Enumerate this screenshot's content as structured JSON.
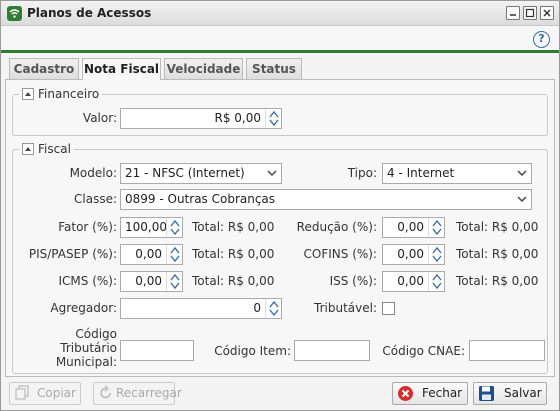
{
  "window": {
    "title": "Planos de Acessos",
    "accent": "#2e7d32"
  },
  "tabs": [
    {
      "label": "Cadastro"
    },
    {
      "label": "Nota Fiscal",
      "active": true
    },
    {
      "label": "Velocidade"
    },
    {
      "label": "Status"
    }
  ],
  "financeiro": {
    "legend": "Financeiro",
    "valor_label": "Valor:",
    "valor_value": "R$ 0,00"
  },
  "fiscal": {
    "legend": "Fiscal",
    "modelo_label": "Modelo:",
    "modelo_value": "21 - NFSC (Internet)",
    "tipo_label": "Tipo:",
    "tipo_value": "4 - Internet",
    "classe_label": "Classe:",
    "classe_value": "0899 - Outras Cobranças",
    "fator_label": "Fator (%):",
    "fator_value": "100,00",
    "fator_total": "Total: R$ 0,00",
    "reducao_label": "Redução (%):",
    "reducao_value": "0,00",
    "reducao_total": "Total: R$ 0,00",
    "pis_label": "PIS/PASEP (%):",
    "pis_value": "0,00",
    "pis_total": "Total: R$ 0,00",
    "cofins_label": "COFINS (%):",
    "cofins_value": "0,00",
    "cofins_total": "Total: R$ 0,00",
    "icms_label": "ICMS (%):",
    "icms_value": "0,00",
    "icms_total": "Total: R$ 0,00",
    "iss_label": "ISS (%):",
    "iss_value": "0,00",
    "iss_total": "Total: R$ 0,00",
    "agregador_label": "Agregador:",
    "agregador_value": "0",
    "tributavel_label": "Tributável:",
    "tributavel_checked": false,
    "codigo_trib_label_1": "Código",
    "codigo_trib_label_2": "Tributário",
    "codigo_trib_label_3": "Municipal:",
    "codigo_trib_value": "",
    "codigo_item_label": "Código Item:",
    "codigo_item_value": "",
    "codigo_cnae_label": "Código CNAE:",
    "codigo_cnae_value": ""
  },
  "footer": {
    "copiar": "Copiar",
    "recarregar": "Recarregar",
    "fechar": "Fechar",
    "salvar": "Salvar"
  },
  "icons": {
    "app": "wifi-icon",
    "help": "help-icon",
    "close": "close-icon",
    "save": "floppy-icon"
  }
}
